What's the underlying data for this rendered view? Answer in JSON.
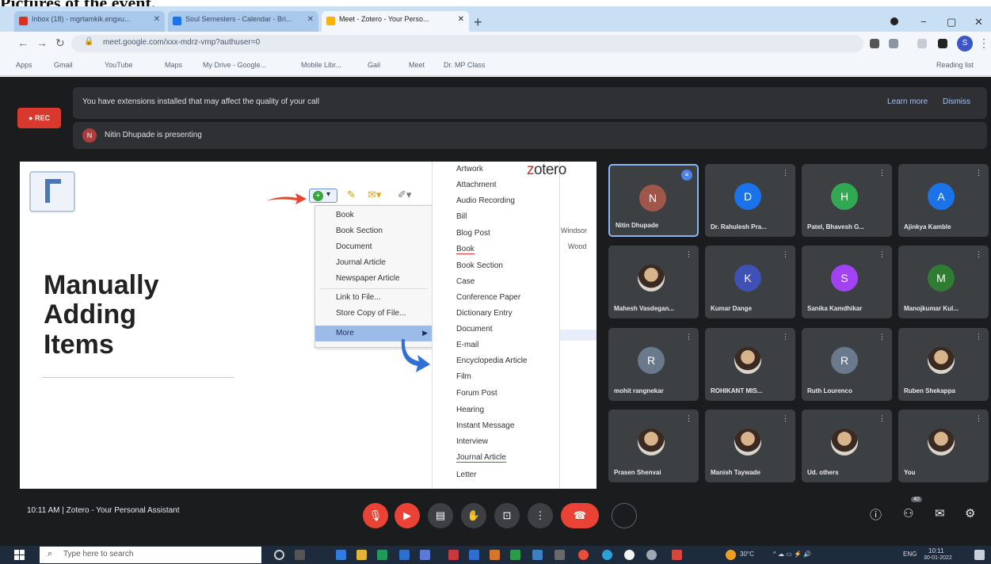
{
  "caption": "Pictures of the event.",
  "browser": {
    "tabs": [
      {
        "label": "Inbox (18) - mgrtamkik.engxu...",
        "color": "#d93025"
      },
      {
        "label": "Soul Semesters - Calendar - Bri...",
        "color": "#1a73e8"
      },
      {
        "label": "Meet - Zotero - Your Perso...",
        "color": "#f6b400",
        "active": true
      }
    ],
    "new_tab": "+",
    "url": "meet.google.com/xxx-mdrz-vmp?authuser=0",
    "bookmarks": [
      "Apps",
      "Gmail",
      "YouTube",
      "Maps",
      "My Drive - Google...",
      "Mobile Libr...",
      "Gail",
      "Meet",
      "Dr. MP Class"
    ],
    "reading_list": "Reading list",
    "profile_initial": "S"
  },
  "meet": {
    "rec_label": "REC",
    "extension_warning": "You have extensions installed that may affect the quality of your call",
    "learn_more": "Learn more",
    "dismiss": "Dismiss",
    "presenter_initial": "N",
    "presenting_msg": "Nitin Dhupade is presenting",
    "meeting_info": "10:11 AM  |  Zotero - Your Personal Assistant"
  },
  "slide": {
    "headline": [
      "Manually",
      "Adding",
      "Items"
    ],
    "zotero_logo": "zotero",
    "add_menu": [
      "Book",
      "Book Section",
      "Document",
      "Journal Article",
      "Newspaper Article",
      "Link to File...",
      "Store Copy of File..."
    ],
    "more_label": "More",
    "item_types": [
      "Artwork",
      "Attachment",
      "Audio Recording",
      "Bill",
      "Blog Post",
      "Book",
      "Book Section",
      "Case",
      "Conference Paper",
      "Dictionary Entry",
      "Document",
      "E-mail",
      "Encyclopedia Article",
      "Film",
      "Forum Post",
      "Hearing",
      "Instant Message",
      "Interview",
      "Journal Article",
      "Letter"
    ],
    "background_text": [
      "Windsor",
      "Wood"
    ]
  },
  "participants": [
    {
      "name": "Nitin Dhupade",
      "initial": "N",
      "color": "#a0564a",
      "speaking": true
    },
    {
      "name": "Dr. Rahulesh Pra...",
      "initial": "D",
      "color": "#1a73e8"
    },
    {
      "name": "Patel, Bhavesh G...",
      "initial": "H",
      "color": "#33a852"
    },
    {
      "name": "Ajinkya Kamble",
      "initial": "A",
      "color": "#1a73e8"
    },
    {
      "name": "Mahesh Vasdegan...",
      "initial": "",
      "photo": true
    },
    {
      "name": "Kumar Dange",
      "initial": "K",
      "color": "#3f51b5"
    },
    {
      "name": "Sanika Kamdhikar",
      "initial": "S",
      "color": "#a142f4"
    },
    {
      "name": "Manojkumar Kul...",
      "initial": "M",
      "color": "#2e7d32"
    },
    {
      "name": "mohit rangnekar",
      "initial": "R",
      "color": "#6a7a8c"
    },
    {
      "name": "ROHIKANT MIS...",
      "initial": "",
      "photo": true
    },
    {
      "name": "Ruth Lourenco",
      "initial": "R",
      "color": "#6a7a8c"
    },
    {
      "name": "Ruben Shekappa",
      "initial": "",
      "photo": true
    },
    {
      "name": "Prasen Shenvai",
      "initial": "",
      "photo": true
    },
    {
      "name": "Manish Taywade",
      "initial": "",
      "photo": true
    },
    {
      "name": "Ud. others",
      "initial": "",
      "photo": true
    },
    {
      "name": "You",
      "initial": "",
      "photo": true
    }
  ],
  "participant_count": "40",
  "taskbar": {
    "search_placeholder": "Type here to search",
    "weather": "30°C",
    "language": "ENG",
    "time": "10:11",
    "date": "30-01-2022"
  }
}
